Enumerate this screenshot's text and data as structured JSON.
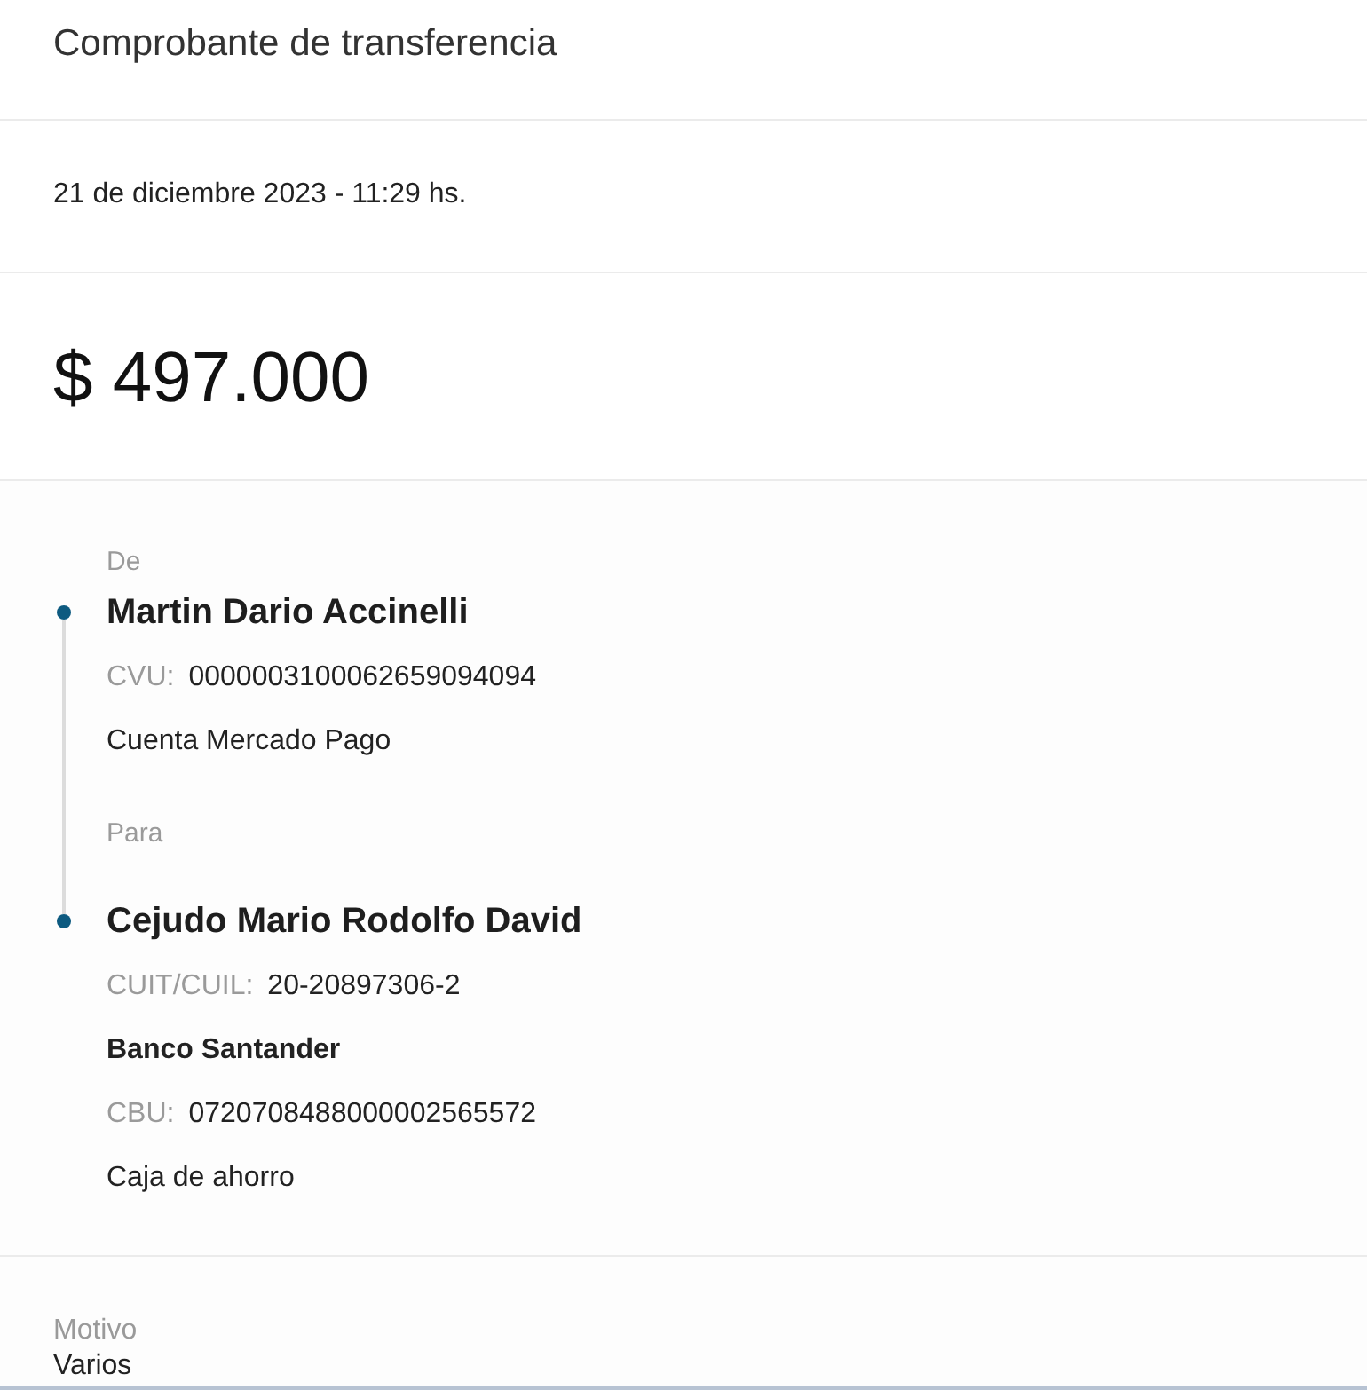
{
  "header": {
    "title": "Comprobante de transferencia"
  },
  "date": "21 de diciembre 2023 - 11:29 hs.",
  "amount": "$ 497.000",
  "parties": [
    {
      "role": "De",
      "name": "Martin Dario Accinelli",
      "lines": [
        {
          "kind": "field",
          "label": "CVU:",
          "value": "0000003100062659094094"
        },
        {
          "kind": "plain",
          "text": "Cuenta Mercado Pago"
        }
      ]
    },
    {
      "role": "Para",
      "name": "Cejudo Mario Rodolfo David",
      "lines": [
        {
          "kind": "field",
          "label": "CUIT/CUIL:",
          "value": "20-20897306-2"
        },
        {
          "kind": "bank",
          "text": "Banco Santander"
        },
        {
          "kind": "field",
          "label": "CBU:",
          "value": "0720708488000002565572"
        },
        {
          "kind": "plain",
          "text": "Caja de ahorro"
        }
      ]
    }
  ],
  "details": [
    {
      "label": "Motivo",
      "value": "Varios"
    }
  ]
}
